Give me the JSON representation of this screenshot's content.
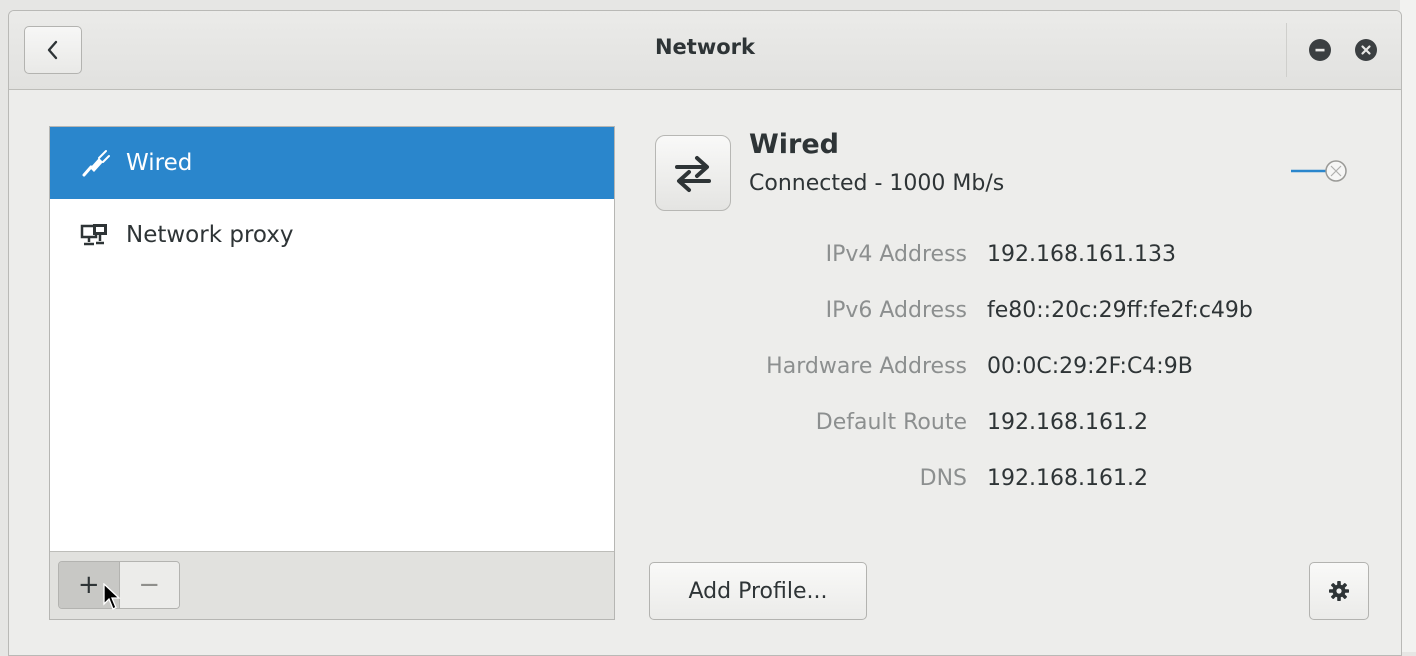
{
  "window": {
    "title": "Network"
  },
  "sidebar": {
    "items": [
      {
        "label": "Wired",
        "icon": "wired-plug-icon",
        "selected": true
      },
      {
        "label": "Network proxy",
        "icon": "network-proxy-icon",
        "selected": false
      }
    ],
    "toolbar": {
      "add_label": "+",
      "remove_label": "−"
    }
  },
  "connection": {
    "icon": "wired-connection-icon",
    "name": "Wired",
    "status": "Connected - 1000 Mb/s",
    "enabled": true,
    "details": [
      {
        "label": "IPv4 Address",
        "value": "192.168.161.133"
      },
      {
        "label": "IPv6 Address",
        "value": "fe80::20c:29ff:fe2f:c49b"
      },
      {
        "label": "Hardware Address",
        "value": "00:0C:29:2F:C4:9B"
      },
      {
        "label": "Default Route",
        "value": "192.168.161.2"
      },
      {
        "label": "DNS",
        "value": "192.168.161.2"
      }
    ]
  },
  "footer": {
    "add_profile_label": "Add Profile..."
  },
  "colors": {
    "accent": "#2a86cc",
    "window_bg": "#ededeb",
    "label_gray": "#8c8f8f"
  }
}
